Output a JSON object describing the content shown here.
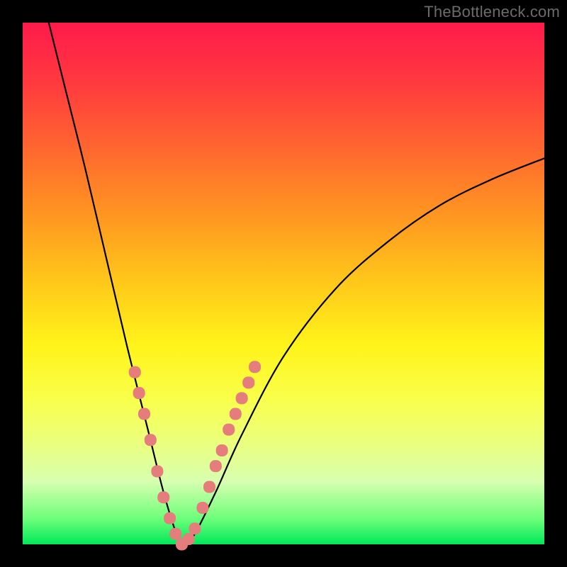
{
  "watermark": "TheBottleneck.com",
  "chart_data": {
    "type": "line",
    "title": "",
    "xlabel": "",
    "ylabel": "",
    "xlim": [
      0,
      1
    ],
    "ylim": [
      0,
      100
    ],
    "background_metric": {
      "description": "bottleneck severity",
      "top_value": 100,
      "top_color": "#ff1a4c",
      "mid_color": "#ffd81a",
      "bottom_value": 0,
      "bottom_color": "#00e85a"
    },
    "series": [
      {
        "name": "bottleneck-curve",
        "color": "#000000",
        "x": [
          0.05,
          0.08,
          0.12,
          0.16,
          0.2,
          0.24,
          0.27,
          0.295,
          0.31,
          0.33,
          0.37,
          0.42,
          0.5,
          0.6,
          0.7,
          0.8,
          0.9,
          1.0
        ],
        "y": [
          100,
          88,
          72,
          55,
          38,
          22,
          10,
          2,
          0,
          2,
          10,
          21,
          36,
          49,
          58,
          65,
          70,
          74
        ]
      }
    ],
    "highlight_points": {
      "name": "data-markers",
      "color": "#e57d7d",
      "x": [
        0.215,
        0.223,
        0.233,
        0.245,
        0.258,
        0.27,
        0.282,
        0.293,
        0.305,
        0.318,
        0.33,
        0.345,
        0.358,
        0.37,
        0.382,
        0.395,
        0.408,
        0.42,
        0.433,
        0.445
      ],
      "y": [
        33,
        29,
        25,
        20,
        14,
        9,
        5,
        2,
        0,
        1,
        3,
        7,
        11,
        15,
        18,
        22,
        25,
        28,
        31,
        34
      ]
    }
  }
}
